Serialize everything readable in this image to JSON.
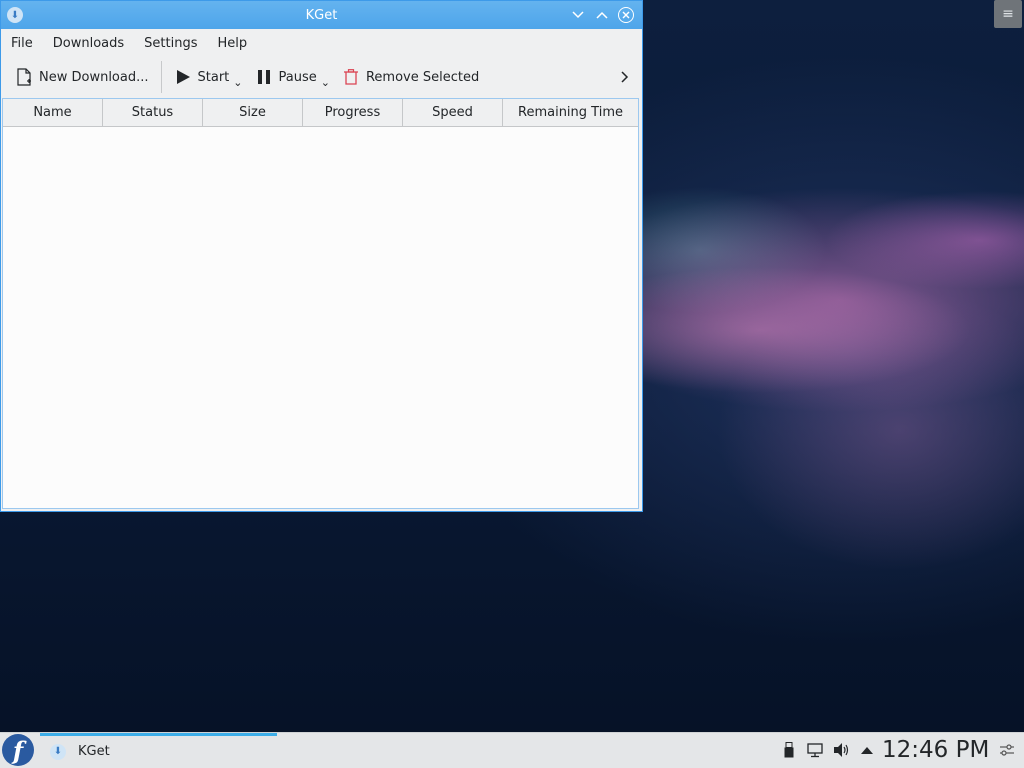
{
  "window": {
    "title": "KGet",
    "menu": [
      "File",
      "Downloads",
      "Settings",
      "Help"
    ],
    "toolbar": {
      "new_download": "New Download...",
      "start": "Start",
      "pause": "Pause",
      "remove_selected": "Remove Selected"
    },
    "columns": [
      "Name",
      "Status",
      "Size",
      "Progress",
      "Speed",
      "Remaining Time"
    ]
  },
  "taskbar": {
    "task_label": "KGet",
    "clock": "12:46 PM"
  },
  "icons": {
    "app": "kget-icon",
    "new_download": "new-document-icon",
    "start": "play-icon",
    "pause": "pause-icon",
    "remove": "trash-icon",
    "more": "chevron-right-icon",
    "launcher": "fedora-logo"
  },
  "colors": {
    "titlebar": "#4ea5ea",
    "focus_border": "#3d9ae9",
    "remove_icon": "#da4453",
    "taskbar_accent": "#3daee9"
  }
}
